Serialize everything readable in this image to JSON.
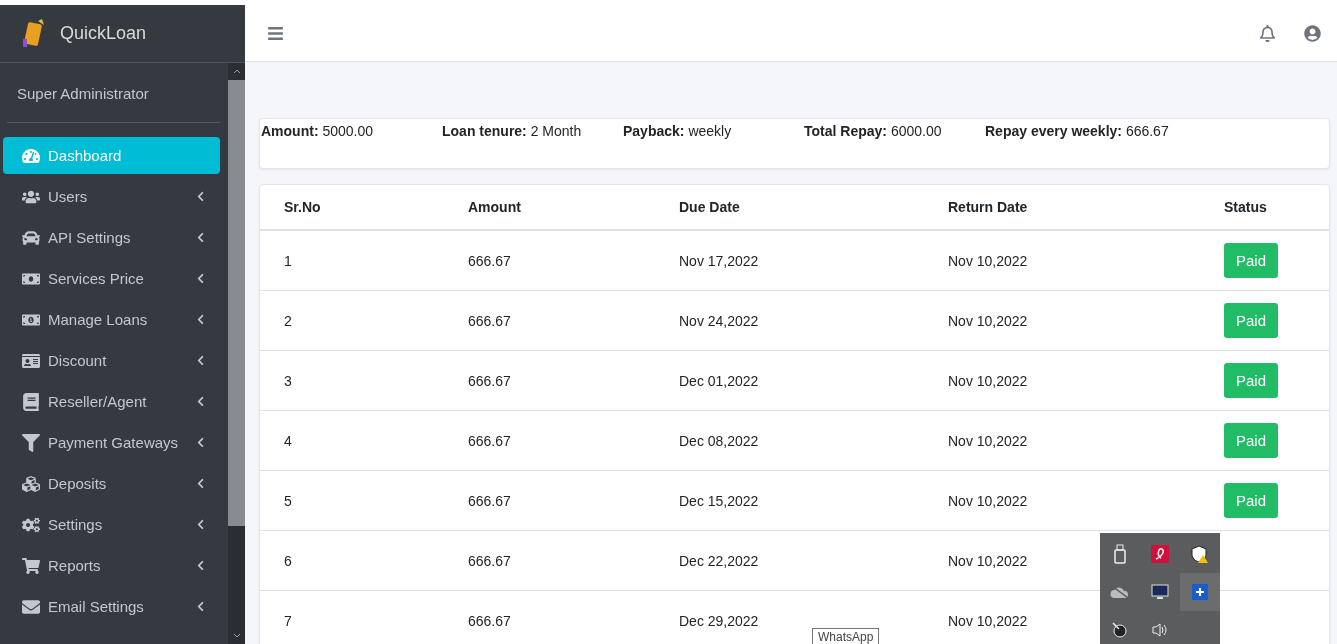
{
  "brand": {
    "name": "QuickLoan"
  },
  "user": {
    "name": "Super Administrator"
  },
  "menu": [
    {
      "label": "Dashboard",
      "selected": true,
      "expandable": false
    },
    {
      "label": "Users",
      "selected": false,
      "expandable": true
    },
    {
      "label": "API Settings",
      "selected": false,
      "expandable": true
    },
    {
      "label": "Services Price",
      "selected": false,
      "expandable": true
    },
    {
      "label": "Manage Loans",
      "selected": false,
      "expandable": true
    },
    {
      "label": "Discount",
      "selected": false,
      "expandable": true
    },
    {
      "label": "Reseller/Agent",
      "selected": false,
      "expandable": true
    },
    {
      "label": "Payment Gateways",
      "selected": false,
      "expandable": true
    },
    {
      "label": "Deposits",
      "selected": false,
      "expandable": true
    },
    {
      "label": "Settings",
      "selected": false,
      "expandable": true
    },
    {
      "label": "Reports",
      "selected": false,
      "expandable": true
    },
    {
      "label": "Email Settings",
      "selected": false,
      "expandable": true
    }
  ],
  "summary": [
    {
      "label": "Amount:",
      "value": "5000.00"
    },
    {
      "label": "Loan tenure:",
      "value": "2 Month"
    },
    {
      "label": "Payback:",
      "value": "weekly"
    },
    {
      "label": "Total Repay:",
      "value": "6000.00"
    },
    {
      "label": "Repay every weekly:",
      "value": "666.67"
    }
  ],
  "table": {
    "columns": [
      "Sr.No",
      "Amount",
      "Due Date",
      "Return Date",
      "Status"
    ],
    "rows": [
      {
        "sr": "1",
        "amount": "666.67",
        "due": "Nov 17,2022",
        "returned": "Nov 10,2022",
        "status": "Paid"
      },
      {
        "sr": "2",
        "amount": "666.67",
        "due": "Nov 24,2022",
        "returned": "Nov 10,2022",
        "status": "Paid"
      },
      {
        "sr": "3",
        "amount": "666.67",
        "due": "Dec 01,2022",
        "returned": "Nov 10,2022",
        "status": "Paid"
      },
      {
        "sr": "4",
        "amount": "666.67",
        "due": "Dec 08,2022",
        "returned": "Nov 10,2022",
        "status": "Paid"
      },
      {
        "sr": "5",
        "amount": "666.67",
        "due": "Dec 15,2022",
        "returned": "Nov 10,2022",
        "status": "Paid"
      },
      {
        "sr": "6",
        "amount": "666.67",
        "due": "Dec 22,2022",
        "returned": "Nov 10,2022"
      },
      {
        "sr": "7",
        "amount": "666.67",
        "due": "Dec 29,2022",
        "returned": "Nov 10,2022"
      }
    ]
  },
  "tooltip": {
    "text": "WhatsApp"
  }
}
